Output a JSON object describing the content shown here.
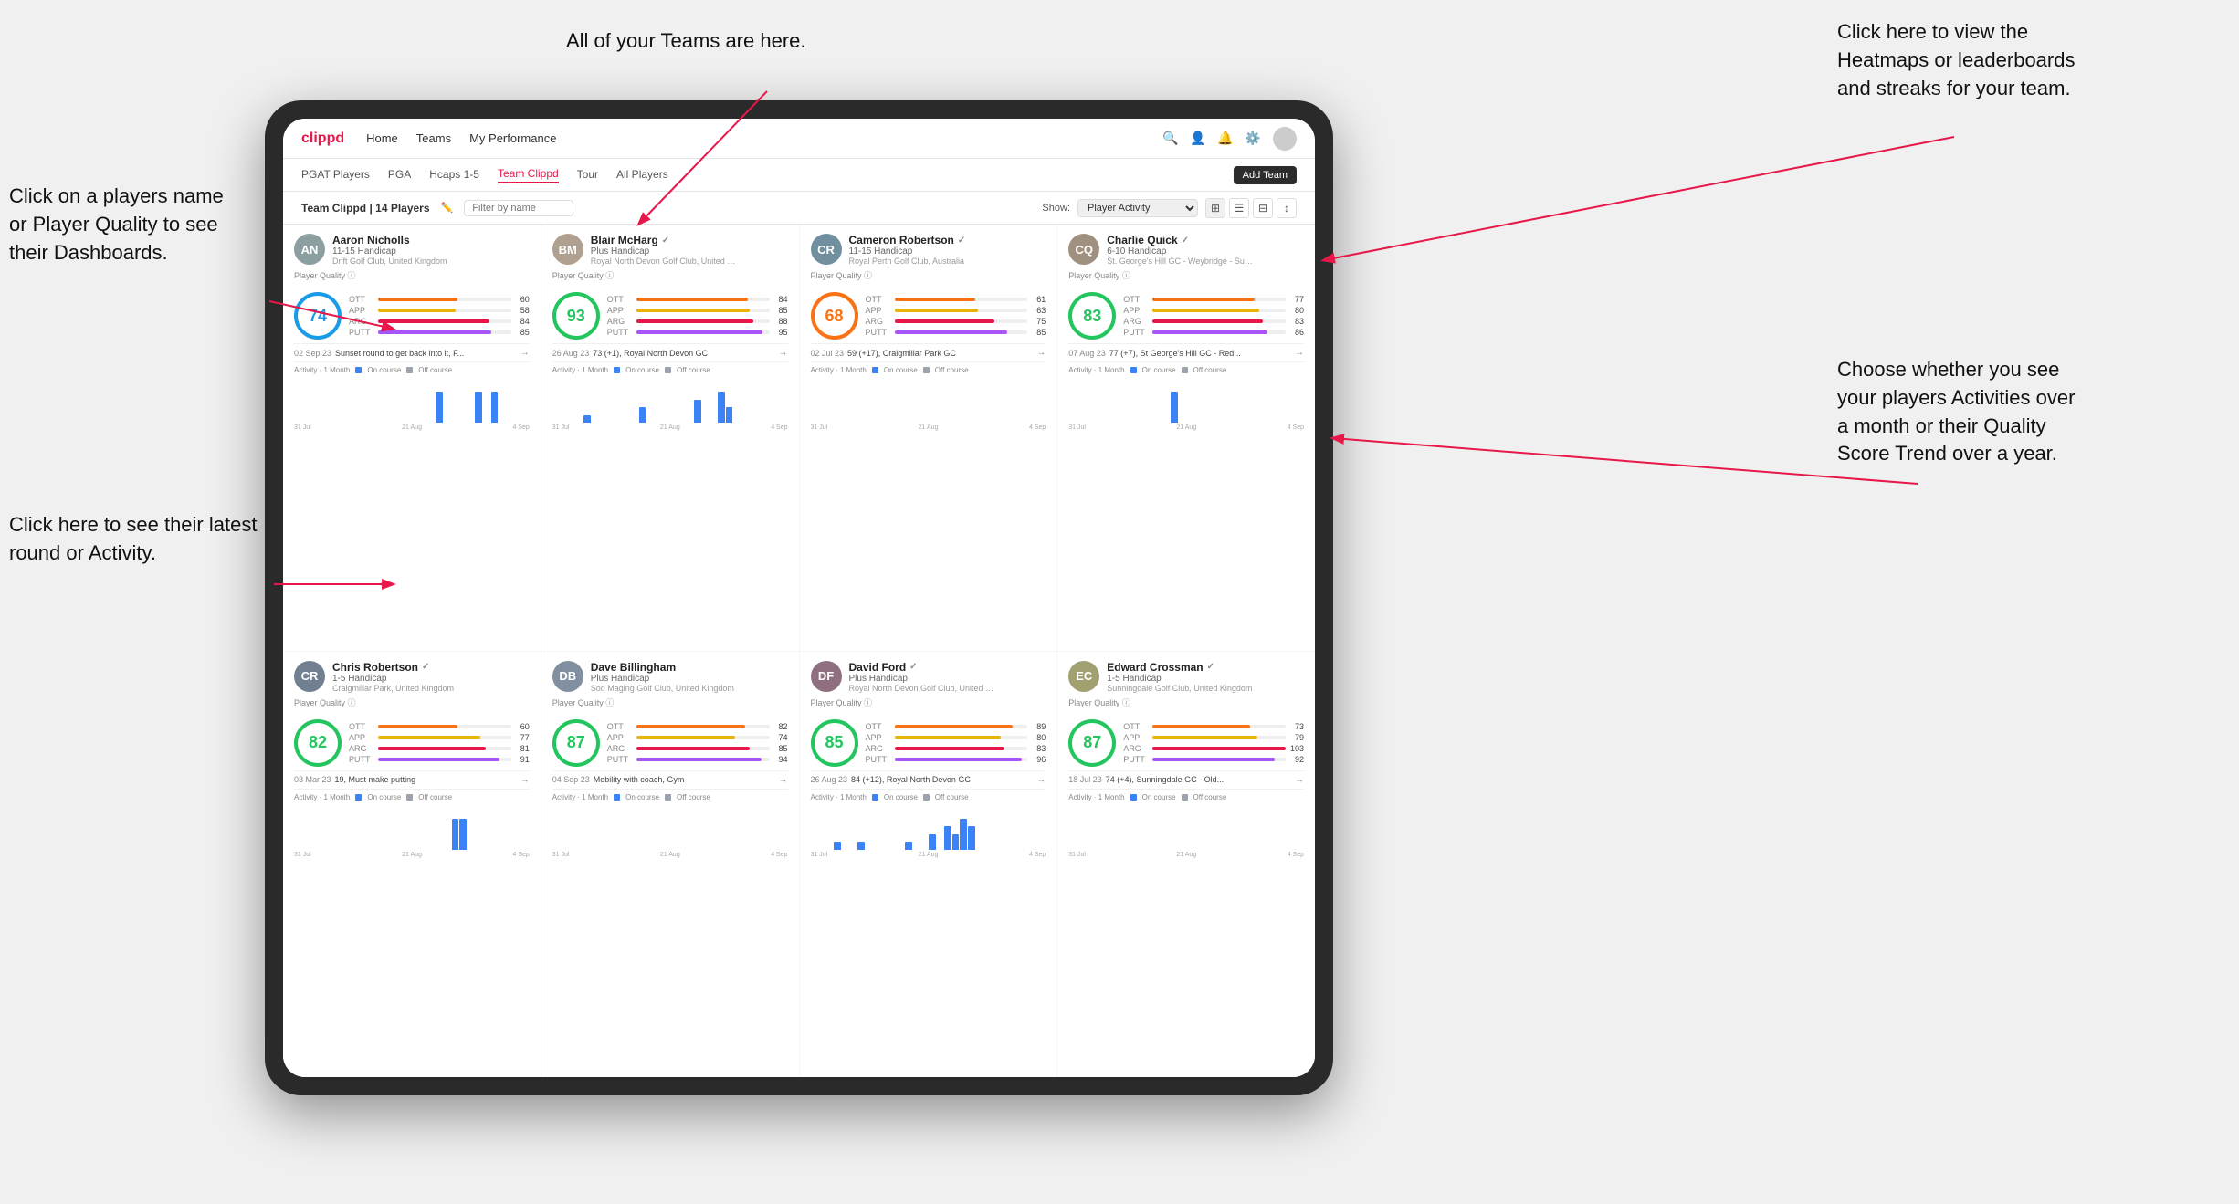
{
  "annotations": {
    "teams_tooltip": "All of your Teams are here.",
    "heatmaps_tooltip": "Click here to view the\nHeatmaps or leaderboards\nand streaks for your team.",
    "player_name_tooltip": "Click on a players name\nor Player Quality to see\ntheir Dashboards.",
    "latest_round_tooltip": "Click here to see their latest\nround or Activity.",
    "activities_tooltip": "Choose whether you see\nyour players Activities over\na month or their Quality\nScore Trend over a year."
  },
  "navbar": {
    "brand": "clippd",
    "links": [
      "Home",
      "Teams",
      "My Performance"
    ]
  },
  "subnav": {
    "tabs": [
      "PGAT Players",
      "PGA",
      "Hcaps 1-5",
      "Team Clippd",
      "Tour",
      "All Players"
    ],
    "active": "Team Clippd",
    "add_team_label": "Add Team"
  },
  "toolbar": {
    "title": "Team Clippd | 14 Players",
    "filter_placeholder": "Filter by name",
    "show_label": "Show:",
    "show_select": "Player Activity"
  },
  "players": [
    {
      "name": "Aaron Nicholls",
      "handicap": "11-15 Handicap",
      "club": "Drift Golf Club, United Kingdom",
      "quality": 74,
      "quality_color": "blue",
      "ott": 60,
      "app": 58,
      "arg": 84,
      "putt": 85,
      "latest_date": "02 Sep 23",
      "latest_text": "Sunset round to get back into it, F...",
      "avatar_color": "#8B9EA0",
      "avatar_initials": "AN",
      "chart_bars": [
        0,
        0,
        0,
        0,
        0,
        0,
        0,
        0,
        0,
        0,
        0,
        0,
        0,
        0,
        0,
        0,
        0,
        0,
        1,
        0,
        0,
        0,
        0,
        1,
        0,
        1,
        0,
        0,
        0,
        0
      ],
      "chart_labels": [
        "31 Jul",
        "21 Aug",
        "4 Sep"
      ]
    },
    {
      "name": "Blair McHarg",
      "handicap": "Plus Handicap",
      "club": "Royal North Devon Golf Club, United Kin...",
      "quality": 93,
      "quality_color": "green",
      "ott": 84,
      "app": 85,
      "arg": 88,
      "putt": 95,
      "latest_date": "26 Aug 23",
      "latest_text": "73 (+1), Royal North Devon GC",
      "avatar_color": "#B0A090",
      "avatar_initials": "BM",
      "chart_bars": [
        0,
        0,
        0,
        0,
        1,
        0,
        0,
        0,
        0,
        0,
        0,
        2,
        0,
        0,
        0,
        0,
        0,
        0,
        3,
        0,
        0,
        4,
        2,
        0,
        0,
        0,
        0,
        0,
        0,
        0
      ],
      "chart_labels": [
        "31 Jul",
        "21 Aug",
        "4 Sep"
      ]
    },
    {
      "name": "Cameron Robertson",
      "handicap": "11-15 Handicap",
      "club": "Royal Perth Golf Club, Australia",
      "quality": 68,
      "quality_color": "orange",
      "ott": 61,
      "app": 63,
      "arg": 75,
      "putt": 85,
      "latest_date": "02 Jul 23",
      "latest_text": "59 (+17), Craigmillar Park GC",
      "avatar_color": "#7090A0",
      "avatar_initials": "CR",
      "chart_bars": [
        0,
        0,
        0,
        0,
        0,
        0,
        0,
        0,
        0,
        0,
        0,
        0,
        0,
        0,
        0,
        0,
        0,
        0,
        0,
        0,
        0,
        0,
        0,
        0,
        0,
        0,
        0,
        0,
        0,
        0
      ],
      "chart_labels": [
        "31 Jul",
        "21 Aug",
        "4 Sep"
      ]
    },
    {
      "name": "Charlie Quick",
      "handicap": "6-10 Handicap",
      "club": "St. George's Hill GC - Weybridge - Surr...",
      "quality": 83,
      "quality_color": "green",
      "ott": 77,
      "app": 80,
      "arg": 83,
      "putt": 86,
      "latest_date": "07 Aug 23",
      "latest_text": "77 (+7), St George's Hill GC - Red...",
      "avatar_color": "#A09080",
      "avatar_initials": "CQ",
      "chart_bars": [
        0,
        0,
        0,
        0,
        0,
        0,
        0,
        0,
        0,
        0,
        0,
        0,
        0,
        2,
        0,
        0,
        0,
        0,
        0,
        0,
        0,
        0,
        0,
        0,
        0,
        0,
        0,
        0,
        0,
        0
      ],
      "chart_labels": [
        "31 Jul",
        "21 Aug",
        "4 Sep"
      ]
    },
    {
      "name": "Chris Robertson",
      "handicap": "1-5 Handicap",
      "club": "Craigmillar Park, United Kingdom",
      "quality": 82,
      "quality_color": "green",
      "ott": 60,
      "app": 77,
      "arg": 81,
      "putt": 91,
      "latest_date": "03 Mar 23",
      "latest_text": "19, Must make putting",
      "avatar_color": "#708090",
      "avatar_initials": "CR",
      "chart_bars": [
        0,
        0,
        0,
        0,
        0,
        0,
        0,
        0,
        0,
        0,
        0,
        0,
        0,
        0,
        0,
        0,
        0,
        0,
        0,
        0,
        1,
        1,
        0,
        0,
        0,
        0,
        0,
        0,
        0,
        0
      ],
      "chart_labels": [
        "31 Jul",
        "21 Aug",
        "4 Sep"
      ]
    },
    {
      "name": "Dave Billingham",
      "handicap": "Plus Handicap",
      "club": "Soq Maging Golf Club, United Kingdom",
      "quality": 87,
      "quality_color": "green",
      "ott": 82,
      "app": 74,
      "arg": 85,
      "putt": 94,
      "latest_date": "04 Sep 23",
      "latest_text": "Mobility with coach, Gym",
      "avatar_color": "#8090A0",
      "avatar_initials": "DB",
      "chart_bars": [
        0,
        0,
        0,
        0,
        0,
        0,
        0,
        0,
        0,
        0,
        0,
        0,
        0,
        0,
        0,
        0,
        0,
        0,
        0,
        0,
        0,
        0,
        0,
        0,
        0,
        0,
        0,
        0,
        0,
        0
      ],
      "chart_labels": [
        "31 Jul",
        "21 Aug",
        "4 Sep"
      ]
    },
    {
      "name": "David Ford",
      "handicap": "Plus Handicap",
      "club": "Royal North Devon Golf Club, United Kin...",
      "quality": 85,
      "quality_color": "green",
      "ott": 89,
      "app": 80,
      "arg": 83,
      "putt": 96,
      "latest_date": "26 Aug 23",
      "latest_text": "84 (+12), Royal North Devon GC",
      "avatar_color": "#907080",
      "avatar_initials": "DF",
      "chart_bars": [
        0,
        0,
        0,
        1,
        0,
        0,
        1,
        0,
        0,
        0,
        0,
        0,
        1,
        0,
        0,
        2,
        0,
        3,
        2,
        4,
        3,
        0,
        0,
        0,
        0,
        0,
        0,
        0,
        0,
        0
      ],
      "chart_labels": [
        "31 Jul",
        "21 Aug",
        "4 Sep"
      ]
    },
    {
      "name": "Edward Crossman",
      "handicap": "1-5 Handicap",
      "club": "Sunningdale Golf Club, United Kingdom",
      "quality": 87,
      "quality_color": "green",
      "ott": 73,
      "app": 79,
      "arg": 103,
      "putt": 92,
      "latest_date": "18 Jul 23",
      "latest_text": "74 (+4), Sunningdale GC - Old...",
      "avatar_color": "#A0A070",
      "avatar_initials": "EC",
      "chart_bars": [
        0,
        0,
        0,
        0,
        0,
        0,
        0,
        0,
        0,
        0,
        0,
        0,
        0,
        0,
        0,
        0,
        0,
        0,
        0,
        0,
        0,
        0,
        0,
        0,
        0,
        0,
        0,
        0,
        0,
        0
      ],
      "chart_labels": [
        "31 Jul",
        "21 Aug",
        "4 Sep"
      ]
    }
  ],
  "activity_labels": {
    "title": "Activity · 1 Month",
    "on_course": "On course",
    "off_course": "Off course"
  },
  "colors": {
    "on_course": "#3b82f6",
    "off_course": "#9ca3af",
    "brand_red": "#e8174a"
  }
}
